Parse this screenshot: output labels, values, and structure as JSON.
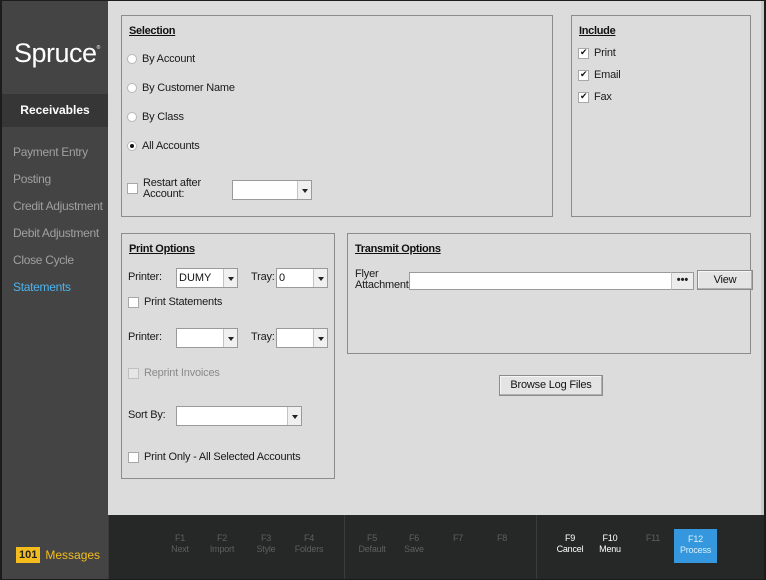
{
  "app": {
    "logo": "Spruce",
    "logo_mark": "®",
    "module": "Receivables"
  },
  "sidebar": {
    "items": [
      {
        "label": "Payment Entry",
        "active": false
      },
      {
        "label": "Posting",
        "active": false
      },
      {
        "label": "Credit Adjustment",
        "active": false
      },
      {
        "label": "Debit Adjustment",
        "active": false
      },
      {
        "label": "Close Cycle",
        "active": false
      },
      {
        "label": "Statements",
        "active": true
      }
    ],
    "messages": {
      "count": "101",
      "label": "Messages"
    }
  },
  "selection": {
    "title": "Selection",
    "options": [
      {
        "label": "By Account",
        "checked": false
      },
      {
        "label": "By Customer Name",
        "checked": false
      },
      {
        "label": "By Class",
        "checked": false
      },
      {
        "label": "All Accounts",
        "checked": true
      }
    ],
    "restart": {
      "label_line1": "Restart after",
      "label_line2": "Account:",
      "checked": false,
      "value": ""
    }
  },
  "include": {
    "title": "Include",
    "items": [
      {
        "label": "Print",
        "checked": true
      },
      {
        "label": "Email",
        "checked": true
      },
      {
        "label": "Fax",
        "checked": true
      }
    ]
  },
  "print_options": {
    "title": "Print Options",
    "printer_label": "Printer:",
    "printer_value": "DUMY",
    "tray_label": "Tray:",
    "tray_value": "0",
    "print_statements": {
      "label": "Print Statements",
      "checked": false
    },
    "printer2_label": "Printer:",
    "printer2_value": "",
    "tray2_label": "Tray:",
    "tray2_value": "",
    "reprint_invoices": {
      "label": "Reprint Invoices",
      "checked": false,
      "disabled": true
    },
    "sort_by_label": "Sort By:",
    "sort_by_value": "",
    "print_only": {
      "label": "Print Only - All Selected Accounts",
      "checked": false
    }
  },
  "transmit_options": {
    "title": "Transmit Options",
    "flyer_label_line1": "Flyer",
    "flyer_label_line2": "Attachment",
    "flyer_value": "",
    "browse_dots": "•••",
    "view_button": "View"
  },
  "browse_log_button": "Browse Log Files",
  "fkeys": [
    {
      "key": "F1",
      "label": "Next",
      "enabled": false
    },
    {
      "key": "F2",
      "label": "Import",
      "enabled": false
    },
    {
      "key": "F3",
      "label": "Style",
      "enabled": false
    },
    {
      "key": "F4",
      "label": "Folders",
      "enabled": false
    },
    {
      "key": "F5",
      "label": "Default",
      "enabled": false
    },
    {
      "key": "F6",
      "label": "Save",
      "enabled": false
    },
    {
      "key": "F7",
      "label": "",
      "enabled": false
    },
    {
      "key": "F8",
      "label": "",
      "enabled": false
    },
    {
      "key": "F9",
      "label": "Cancel",
      "enabled": true
    },
    {
      "key": "F10",
      "label": "Menu",
      "enabled": true
    },
    {
      "key": "F11",
      "label": "",
      "enabled": false
    },
    {
      "key": "F12",
      "label": "Process",
      "enabled": true,
      "primary": true
    }
  ],
  "colors": {
    "accent": "#3598de",
    "active_nav": "#4db3ee",
    "messages": "#f4bc1d",
    "sidebar_bg": "#434443",
    "fkey_bar_bg": "#262827"
  }
}
